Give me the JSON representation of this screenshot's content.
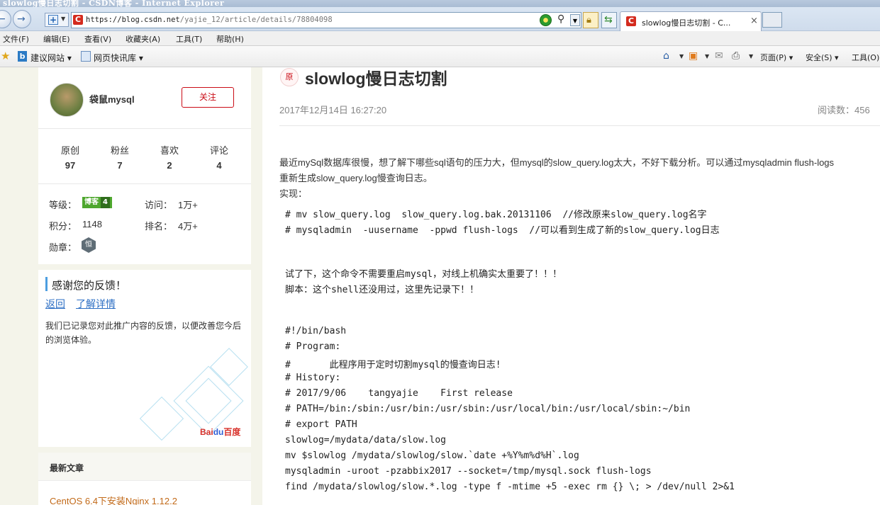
{
  "window": {
    "title": "slowlog慢日志切割 - CSDN博客 - Internet Explorer"
  },
  "toolbar": {
    "url_host": "https://blog.csdn.net",
    "url_path": "/yajie_12/article/details/78804098",
    "tab_title": "slowlog慢日志切割 - C...",
    "tab_close": "×"
  },
  "menu": [
    "文件(F)",
    "编辑(E)",
    "查看(V)",
    "收藏夹(A)",
    "工具(T)",
    "帮助(H)"
  ],
  "favorites": {
    "suggested_sites": "建议网站 ▾",
    "web_slice_gallery": "网页快讯库 ▾",
    "page_menu": "页面(P) ▾",
    "safety_menu": "安全(S) ▾",
    "tools_menu": "工具(O)"
  },
  "profile": {
    "username": "袋鼠mysql",
    "follow_label": "关注",
    "stats": [
      {
        "label": "原创",
        "value": "97"
      },
      {
        "label": "粉丝",
        "value": "7"
      },
      {
        "label": "喜欢",
        "value": "2"
      },
      {
        "label": "评论",
        "value": "4"
      }
    ],
    "level_label": "等级：",
    "level_badge": "博客",
    "level_num": "4",
    "visits_label": "访问：",
    "visits_value": "1万+",
    "points_label": "积分：",
    "points_value": "1148",
    "rank_label": "排名：",
    "rank_value": "4万+",
    "medal_label": "勋章：",
    "medal_glyph": "恒"
  },
  "feedback": {
    "title": "感谢您的反馈！",
    "back_link": "返回",
    "learn_more_link": "了解详情",
    "body": "我们已记录您对此推广内容的反馈，以便改善您今后的浏览体验。",
    "brand_bai": "Bai",
    "brand_paw": "du",
    "brand_cn": "百度"
  },
  "recent": {
    "title": "最新文章",
    "first_item": "CentOS 6.4下安装Nginx 1.12.2"
  },
  "article": {
    "badge": "原",
    "title": "slowlog慢日志切割",
    "date": "2017年12月14日 16:27:20",
    "reads": "阅读数：456",
    "intro_line1": "最近mySql数据库很慢，想了解下哪些sql语句的压力大，但mysql的slow_query.log太大，不好下载分析。可以通过mysqladmin flush-logs",
    "intro_line2": "重新生成slow_query.log慢查询日志。",
    "intro_line3": "实现：",
    "code_block1": [
      "# mv slow_query.log  slow_query.log.bak.20131106  //修改原来slow_query.log名字",
      "# mysqladmin  -uusername  -ppwd flush-logs  //可以看到生成了新的slow_query.log日志"
    ],
    "note_lines": [
      "试了下，这个命令不需要重启mysql，对线上机确实太重要了！！！",
      "脚本：这个shell还没用过，这里先记录下！！"
    ],
    "script_lines": [
      "#!/bin/bash",
      "# Program:",
      "#       此程序用于定时切割mysql的慢查询日志!",
      "# History:",
      "# 2017/9/06    tangyajie    First release",
      "# PATH=/bin:/sbin:/usr/bin:/usr/sbin:/usr/local/bin:/usr/local/sbin:~/bin",
      "# export PATH",
      "slowlog=/mydata/data/slow.log",
      "mv $slowlog /mydata/slowlog/slow.`date +%Y%m%d%H`.log",
      "mysqladmin -uroot -pzabbix2017 --socket=/tmp/mysql.sock flush-logs",
      "find /mydata/slowlog/slow.*.log -type f -mtime +5 -exec rm {} \\; > /dev/null 2>&1"
    ]
  },
  "colors": {
    "csdn_red": "#ca0c16",
    "link_blue": "#2d6fc4",
    "recent_orange": "#c26a19",
    "page_bg": "#f4f4ea"
  }
}
